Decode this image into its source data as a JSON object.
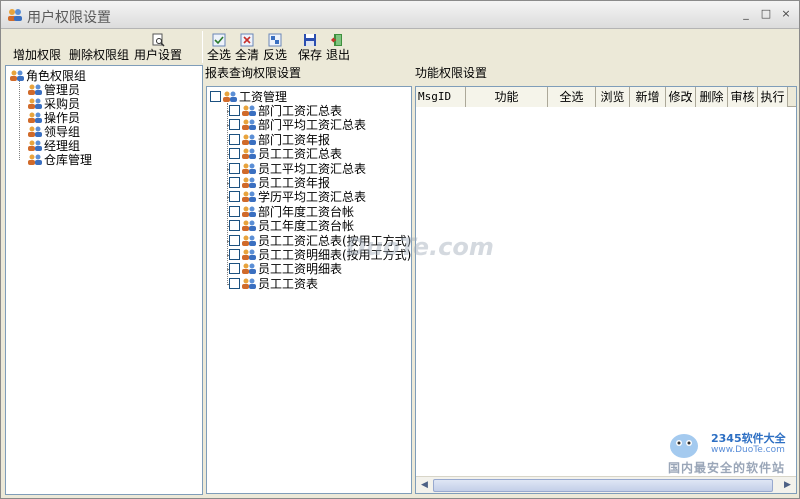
{
  "window": {
    "title": "用户权限设置",
    "minimize": "_",
    "maximize": "□",
    "close": "×"
  },
  "toolbar_left": [
    {
      "label": "增加权限",
      "icon": "none"
    },
    {
      "label": "删除权限组",
      "icon": "none"
    },
    {
      "label": "用户设置",
      "icon": "document-search-icon"
    }
  ],
  "toolbar_right": [
    {
      "label": "全选",
      "icon": "select-all-icon"
    },
    {
      "label": "全清",
      "icon": "clear-all-icon"
    },
    {
      "label": "反选",
      "icon": "invert-select-icon"
    },
    {
      "label": "保存",
      "icon": "save-disk-icon"
    },
    {
      "label": "退出",
      "icon": "exit-door-icon"
    }
  ],
  "roles": {
    "root": "角色权限组",
    "items": [
      "管理员",
      "采购员",
      "操作员",
      "领导组",
      "经理组",
      "仓库管理"
    ]
  },
  "report_pane": {
    "label": "报表查询权限设置",
    "root": "工资管理",
    "items": [
      "部门工资汇总表",
      "部门平均工资汇总表",
      "部门工资年报",
      "员工工资汇总表",
      "员工平均工资汇总表",
      "员工工资年报",
      "学历平均工资汇总表",
      "部门年度工资台帐",
      "员工年度工资台帐",
      "员工工资汇总表(按用工方式)",
      "员工工资明细表(按用工方式)",
      "员工工资明细表",
      "员工工资表"
    ]
  },
  "function_pane": {
    "label": "功能权限设置",
    "columns": [
      "MsgID",
      "功能",
      "全选",
      "浏览",
      "新增",
      "修改",
      "删除",
      "审核",
      "执行"
    ]
  },
  "watermark": {
    "text": "DuoTe.com"
  },
  "brand": {
    "line1": "2345软件大全",
    "line2": "www.DuoTe.com",
    "line3": "国内最安全的软件站"
  },
  "colors": {
    "checkbox_border": "#1c5180",
    "pane_border": "#7f9db9",
    "window_bg": "#ece9d8"
  }
}
